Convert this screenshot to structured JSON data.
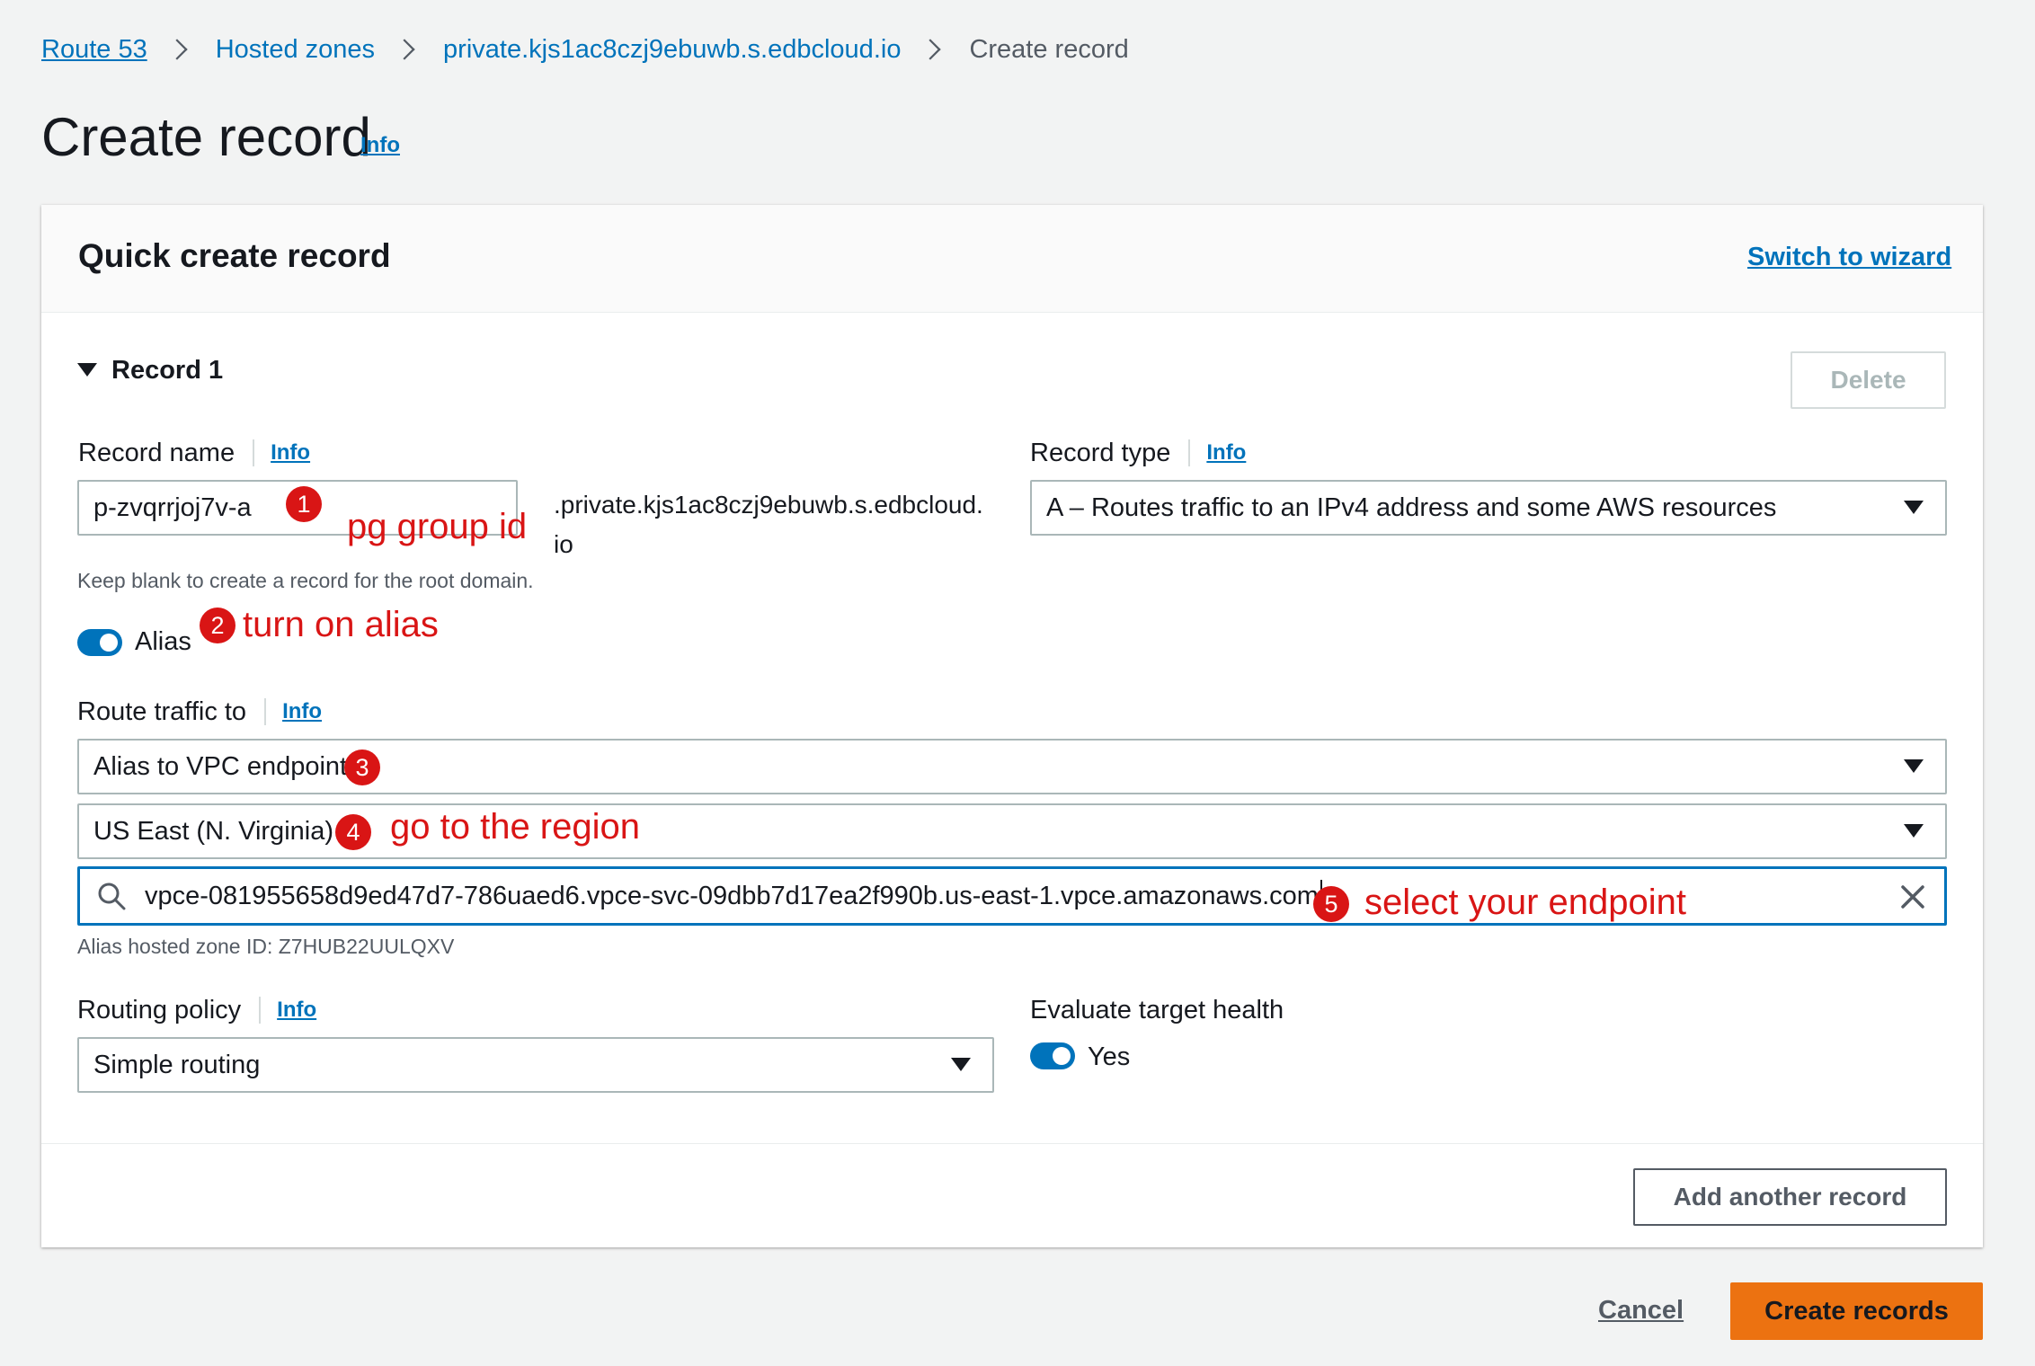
{
  "breadcrumb": {
    "items": [
      "Route 53",
      "Hosted zones",
      "private.kjs1ac8czj9ebuwb.s.edbcloud.io"
    ],
    "current": "Create record"
  },
  "page": {
    "title": "Create record",
    "info": "Info"
  },
  "panel": {
    "title": "Quick create record",
    "switch_link": "Switch to wizard",
    "record_title": "Record 1",
    "delete_label": "Delete"
  },
  "record_name": {
    "label": "Record name",
    "info": "Info",
    "value": "p-zvqrrjoj7v-a",
    "suffix_line1": ".private.kjs1ac8czj9ebuwb.s.edbcloud.",
    "suffix_line2": "io",
    "hint": "Keep blank to create a record for the root domain."
  },
  "record_type": {
    "label": "Record type",
    "info": "Info",
    "value": "A – Routes traffic to an IPv4 address and some AWS resources"
  },
  "alias": {
    "label": "Alias",
    "enabled": true
  },
  "route_traffic": {
    "label": "Route traffic to",
    "info": "Info",
    "endpoint_type": "Alias to VPC endpoint",
    "region": "US East (N. Virginia)",
    "endpoint_value": "vpce-081955658d9ed47d7-786uaed6.vpce-svc-09dbb7d17ea2f990b.us-east-1.vpce.amazonaws.com",
    "hosted_zone": "Alias hosted zone ID: Z7HUB22UULQXV"
  },
  "routing_policy": {
    "label": "Routing policy",
    "info": "Info",
    "value": "Simple routing"
  },
  "target_health": {
    "label": "Evaluate target health",
    "value": "Yes",
    "enabled": true
  },
  "footer": {
    "add_label": "Add another record",
    "cancel_label": "Cancel",
    "create_label": "Create records"
  },
  "annotations": {
    "a1": {
      "num": "1",
      "text": "pg group id"
    },
    "a2": {
      "num": "2",
      "text": "turn on alias"
    },
    "a3": {
      "num": "3",
      "text": ""
    },
    "a4": {
      "num": "4",
      "text": "go to the region"
    },
    "a5": {
      "num": "5",
      "text": "select your endpoint"
    }
  },
  "colors": {
    "link": "#0073bb",
    "primary": "#ec7211",
    "annotation": "#d91515"
  }
}
